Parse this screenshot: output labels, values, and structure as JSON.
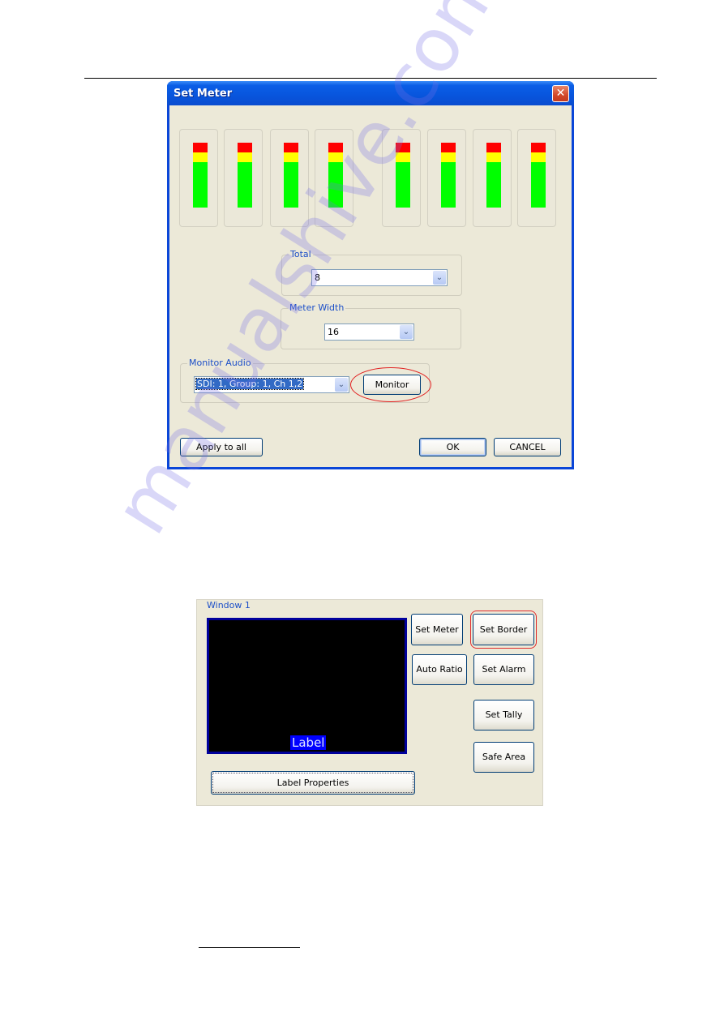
{
  "dialog": {
    "title": "Set Meter",
    "close_icon": "close-icon",
    "meters": {
      "count": 8,
      "levels": [
        {
          "red": true,
          "yellow": true,
          "green": true
        },
        {
          "red": true,
          "yellow": true,
          "green": true
        },
        {
          "red": true,
          "yellow": true,
          "green": true
        },
        {
          "red": true,
          "yellow": true,
          "green": true
        },
        {
          "red": true,
          "yellow": true,
          "green": true
        },
        {
          "red": true,
          "yellow": true,
          "green": true
        },
        {
          "red": true,
          "yellow": true,
          "green": true
        },
        {
          "red": true,
          "yellow": true,
          "green": true
        }
      ],
      "colors": {
        "red": "#ff0000",
        "yellow": "#ffff00",
        "green": "#00ff00"
      }
    },
    "total": {
      "label": "Total",
      "value": "8"
    },
    "meter_width": {
      "label": "Meter Width",
      "value": "16"
    },
    "monitor_audio": {
      "label": "Monitor Audio",
      "value": "SDI: 1, Group: 1, Ch 1,2",
      "monitor_button": "Monitor"
    },
    "buttons": {
      "apply_to_all": "Apply to all",
      "ok": "OK",
      "cancel": "CANCEL"
    }
  },
  "window_panel": {
    "title": "Window 1",
    "preview_label": "Label",
    "buttons": {
      "set_meter": "Set Meter",
      "set_border": "Set Border",
      "auto_ratio": "Auto Ratio",
      "set_alarm": "Set Alarm",
      "set_tally": "Set Tally",
      "safe_area": "Safe Area",
      "label_properties": "Label Properties"
    }
  },
  "watermark": "manualshive.com",
  "highlight_color": "#e12020"
}
